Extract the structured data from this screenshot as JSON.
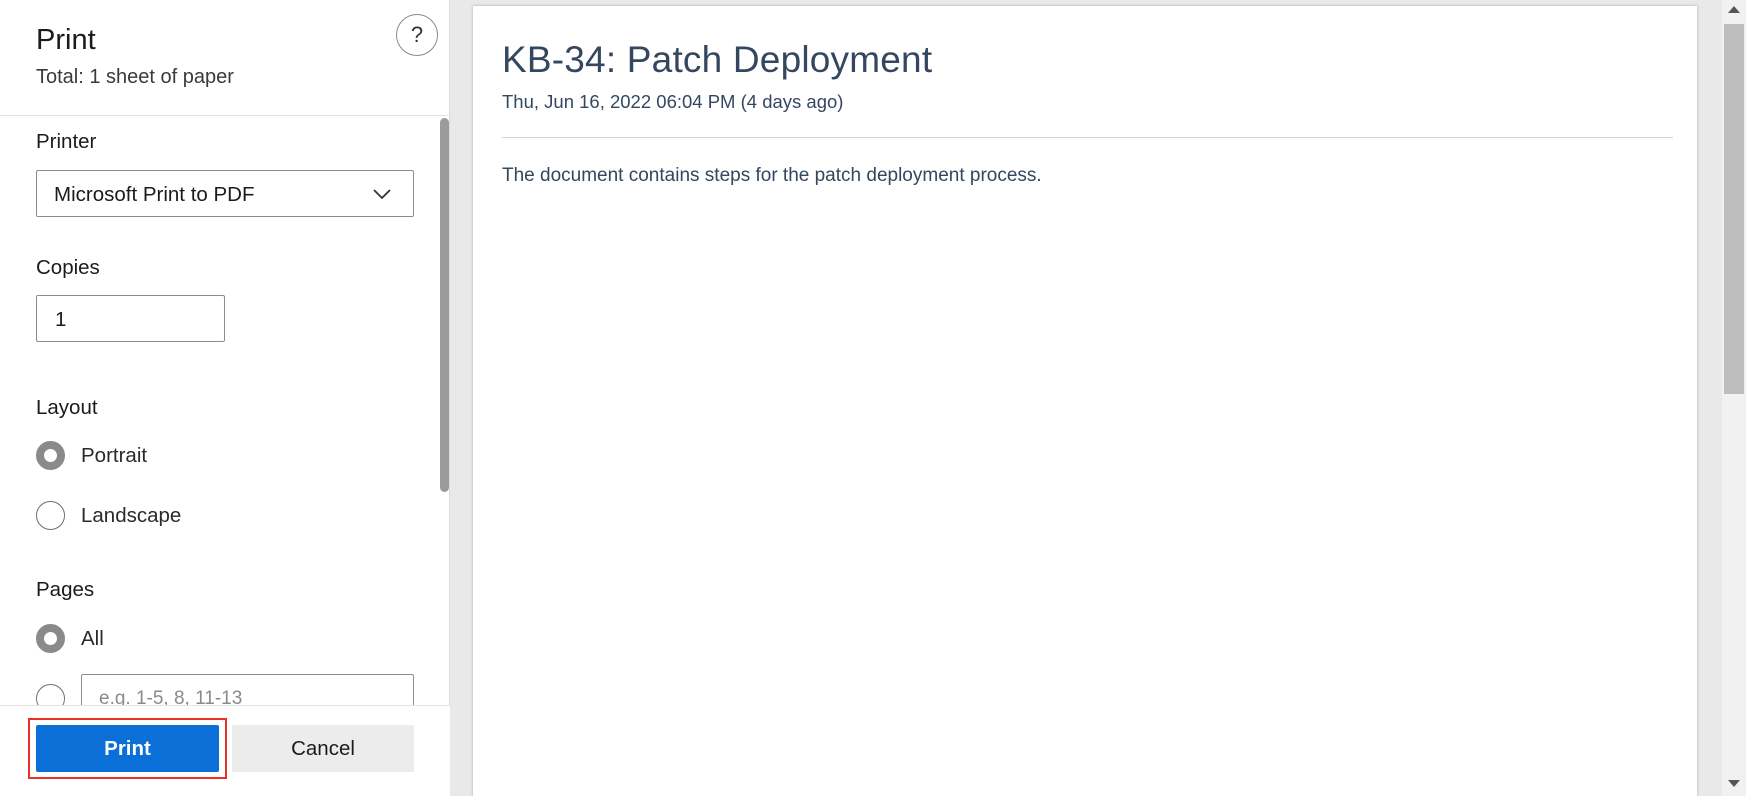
{
  "dialog": {
    "title": "Print",
    "total_sheets": "Total: 1 sheet of paper",
    "help_glyph": "?"
  },
  "printer": {
    "label": "Printer",
    "selected": "Microsoft Print to PDF"
  },
  "copies": {
    "label": "Copies",
    "value": "1"
  },
  "layout": {
    "label": "Layout",
    "options": [
      {
        "label": "Portrait",
        "checked": true
      },
      {
        "label": "Landscape",
        "checked": false
      }
    ]
  },
  "pages": {
    "label": "Pages",
    "all_label": "All",
    "all_checked": true,
    "custom_placeholder": "e.g. 1-5, 8, 11-13"
  },
  "footer": {
    "print_label": "Print",
    "cancel_label": "Cancel",
    "highlight_color": "#e5332a",
    "accent_color": "#0a6fd6"
  },
  "document": {
    "title": "KB-34: Patch Deployment",
    "date": "Thu, Jun 16, 2022 06:04 PM (4 days ago)",
    "body": "The document contains steps for the patch deployment process."
  }
}
